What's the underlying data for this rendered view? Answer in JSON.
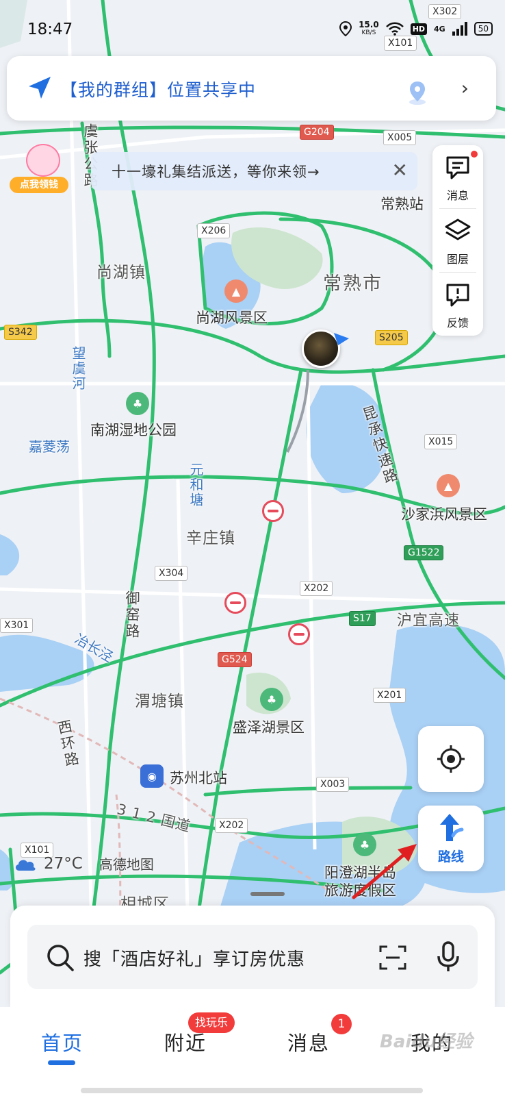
{
  "status_bar": {
    "time": "18:47",
    "speed_value": "15.0",
    "speed_unit": "KB/S",
    "hd": "HD",
    "network": "4G",
    "battery": "50"
  },
  "share_card": {
    "text": "【我的群组】位置共享中"
  },
  "promo": {
    "label": "点我领钱"
  },
  "tip_banner": {
    "text": "十一壕礼集结派送，等你来领→",
    "close": "✕"
  },
  "right_toolbar": {
    "items": [
      {
        "label": "消息",
        "icon": "message-icon"
      },
      {
        "label": "图层",
        "icon": "layers-icon"
      },
      {
        "label": "反馈",
        "icon": "feedback-icon"
      }
    ]
  },
  "map": {
    "towns": [
      "尚湖镇",
      "常熟市",
      "辛庄镇",
      "渭塘镇",
      "相城区"
    ],
    "stations": [
      "常熟站",
      "苏州北站"
    ],
    "water": [
      "嘉菱荡",
      "望虞河",
      "元和塘",
      "冶长泾"
    ],
    "roads": [
      "虞张公路",
      "昆承快速路",
      "御窑路",
      "西环路",
      "沪宜高速",
      "3 1 2 国道"
    ],
    "scenic": [
      "尚湖风景区",
      "南湖湿地公园",
      "沙家浜风景区",
      "盛泽湖景区",
      "阳澄湖半岛",
      "旅游度假区"
    ],
    "shields": [
      "X302",
      "X101",
      "G204",
      "X005",
      "X206",
      "S342",
      "S205",
      "X015",
      "G1522",
      "X304",
      "X202",
      "S17",
      "G524",
      "X201",
      "X003",
      "X202",
      "X101",
      "X301"
    ]
  },
  "weather": {
    "temperature": "27°C",
    "brand": "高德地图"
  },
  "route_button": {
    "label": "路线"
  },
  "search": {
    "placeholder": "搜「酒店好礼」享订房优惠"
  },
  "tabs": [
    {
      "label": "首页",
      "active": true
    },
    {
      "label": "附近",
      "badge": "找玩乐"
    },
    {
      "label": "消息",
      "badge": "1"
    },
    {
      "label": "我的"
    }
  ],
  "watermark": "Baidu经验",
  "colors": {
    "accent": "#1f6fe0",
    "road_green": "#2fbf6f",
    "water": "#a9d0f5",
    "badge_red": "#f23b3b"
  }
}
